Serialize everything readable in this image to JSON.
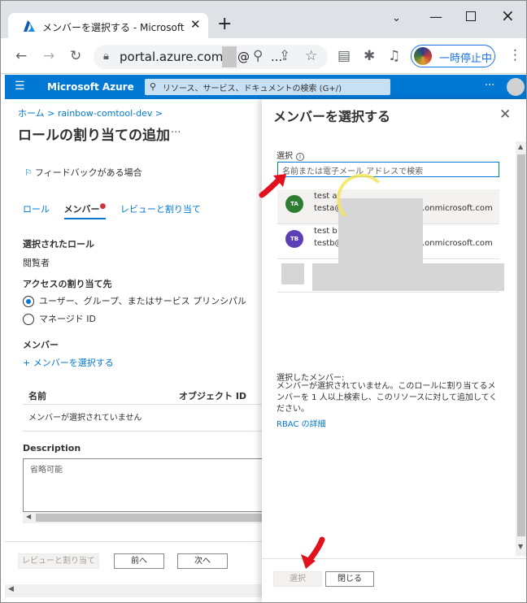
{
  "browser": {
    "tab_title": "メンバーを選択する - Microsoft Azure",
    "tab_close": "✕",
    "new_tab": "+",
    "url": "portal.azure.com/#@",
    "url_suffix": "...",
    "profile_label": "一時停止中"
  },
  "azure": {
    "brand": "Microsoft Azure",
    "search_placeholder": "リソース、サービス、ドキュメントの検索 (G+/)",
    "more": "···"
  },
  "blade": {
    "breadcrumb": "ホーム > rainbow-comtool-dev >",
    "title": "ロールの割り当ての追加",
    "more": "···",
    "feedback": "フィードバックがある場合",
    "tabs": {
      "role": "ロール",
      "member": "メンバー",
      "member_dot": "●",
      "review": "レビューと割り当て"
    },
    "selected_role_label": "選択されたロール",
    "selected_role_value": "閲覧者",
    "access_label": "アクセスの割り当て先",
    "radio_user": "ユーザー、グループ、またはサービス プリンシパル",
    "radio_managed": "マネージド ID",
    "member_label": "メンバー",
    "select_member_link": "+ メンバーを選択する",
    "col_name": "名前",
    "col_object_id": "オブジェクト ID",
    "no_member": "メンバーが選択されていません",
    "description_label": "Description",
    "description_placeholder": "省略可能",
    "btn_review": "レビューと割り当て",
    "btn_prev": "前へ",
    "btn_next": "次へ"
  },
  "panel": {
    "title": "メンバーを選択する",
    "close": "✕",
    "select_label": "選択",
    "search_placeholder": "名前または電子メール アドレスで検索",
    "users": [
      {
        "initials": "TA",
        "name": "test a",
        "email_prefix": "testa@",
        "email_suffix": ".onmicrosoft.com",
        "color": "#2e7d32"
      },
      {
        "initials": "TB",
        "name": "test b",
        "email_prefix": "testb@",
        "email_suffix": ".onmicrosoft.com",
        "color": "#5c3fb5"
      }
    ],
    "selected_members_label": "選択したメンバー:",
    "no_member_msg": "メンバーが選択されていません。このロールに割り当てるメンバーを 1 人以上検索し、このリソースに対して追加してください。",
    "rbac_link": "RBAC の詳細",
    "btn_select": "選択",
    "btn_close": "閉じる"
  },
  "colors": {
    "azure_blue": "#0078d4",
    "annotation_red": "#e3101e",
    "annotation_yellow": "#f5e65a"
  }
}
